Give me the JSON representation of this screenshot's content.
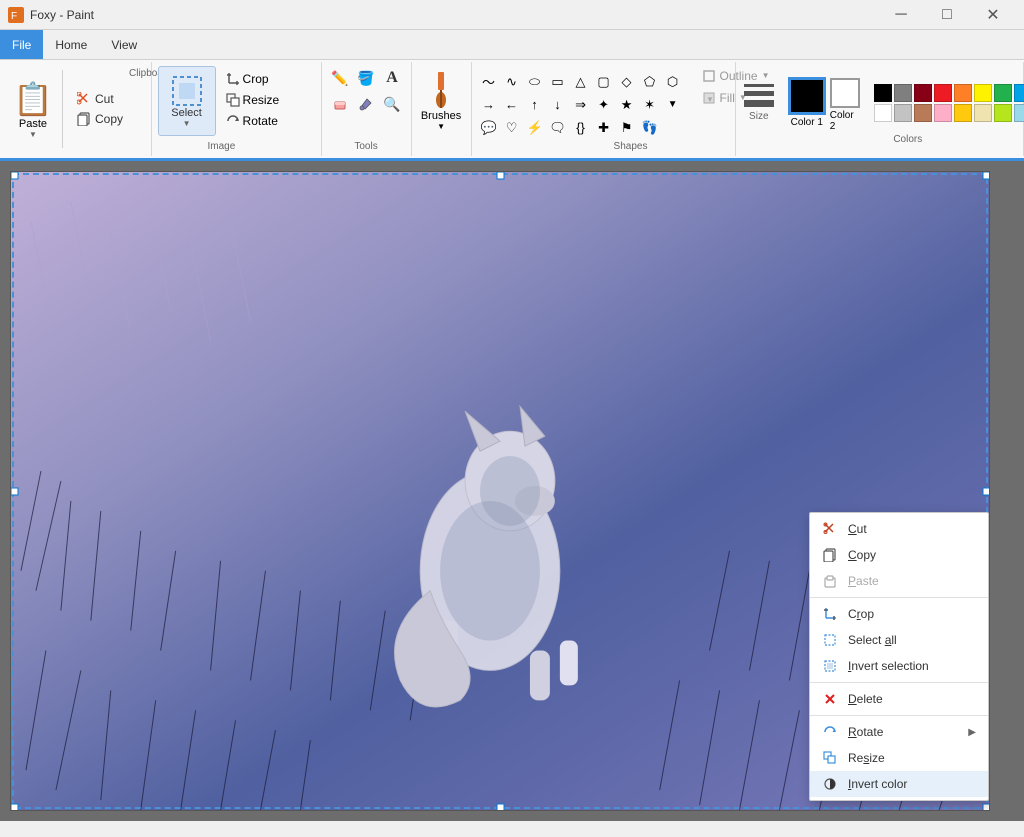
{
  "app": {
    "title": "Foxy - Paint",
    "window_controls": {
      "minimize": "─",
      "maximize": "□",
      "close": "✕"
    }
  },
  "menu": {
    "items": [
      {
        "id": "file",
        "label": "File",
        "active": true
      },
      {
        "id": "home",
        "label": "Home",
        "active": false
      },
      {
        "id": "view",
        "label": "View",
        "active": false
      }
    ]
  },
  "ribbon": {
    "groups": {
      "clipboard": {
        "label": "Clipboard",
        "paste": "Paste",
        "cut": "Cut",
        "copy": "Copy"
      },
      "image": {
        "label": "Image",
        "crop": "Crop",
        "resize": "Resize",
        "rotate": "Rotate",
        "select": "Select"
      },
      "tools": {
        "label": "Tools"
      },
      "shapes": {
        "label": "Shapes",
        "outline": "Outline",
        "fill": "Fill"
      },
      "brushes": {
        "label": "",
        "name": "Brushes"
      },
      "colors": {
        "label": "Colors",
        "size_label": "Size",
        "color1_label": "Color 1",
        "color2_label": "Color 2"
      }
    }
  },
  "context_menu": {
    "items": [
      {
        "id": "cut",
        "label": "Cut",
        "icon": "scissors",
        "disabled": false,
        "has_arrow": false
      },
      {
        "id": "copy",
        "label": "Copy",
        "icon": "copy",
        "disabled": false,
        "has_arrow": false
      },
      {
        "id": "paste",
        "label": "Paste",
        "icon": "paste",
        "disabled": true,
        "has_arrow": false
      },
      {
        "id": "crop",
        "label": "Crop",
        "icon": "crop",
        "disabled": false,
        "has_arrow": false
      },
      {
        "id": "select-all",
        "label": "Select all",
        "icon": "select",
        "disabled": false,
        "has_arrow": false
      },
      {
        "id": "invert-selection",
        "label": "Invert selection",
        "icon": "invert-sel",
        "disabled": false,
        "has_arrow": false
      },
      {
        "id": "delete",
        "label": "Delete",
        "icon": "delete",
        "disabled": false,
        "has_arrow": false
      },
      {
        "id": "rotate",
        "label": "Rotate",
        "icon": "rotate",
        "disabled": false,
        "has_arrow": true
      },
      {
        "id": "resize",
        "label": "Resize",
        "icon": "resize",
        "disabled": false,
        "has_arrow": false
      },
      {
        "id": "invert-color",
        "label": "Invert color",
        "icon": "invert-color",
        "disabled": false,
        "has_arrow": false,
        "active": true
      }
    ]
  },
  "palette": {
    "row1": [
      "#000000",
      "#7f7f7f",
      "#880015",
      "#ed1c24",
      "#ff7f27",
      "#fff200",
      "#22b14c",
      "#00a2e8",
      "#3f48cc",
      "#a349a4"
    ],
    "row2": [
      "#ffffff",
      "#c3c3c3",
      "#b97a57",
      "#ffaec9",
      "#ffc90e",
      "#efe4b0",
      "#b5e61d",
      "#99d9ea",
      "#7092be",
      "#c8bfe7"
    ]
  }
}
